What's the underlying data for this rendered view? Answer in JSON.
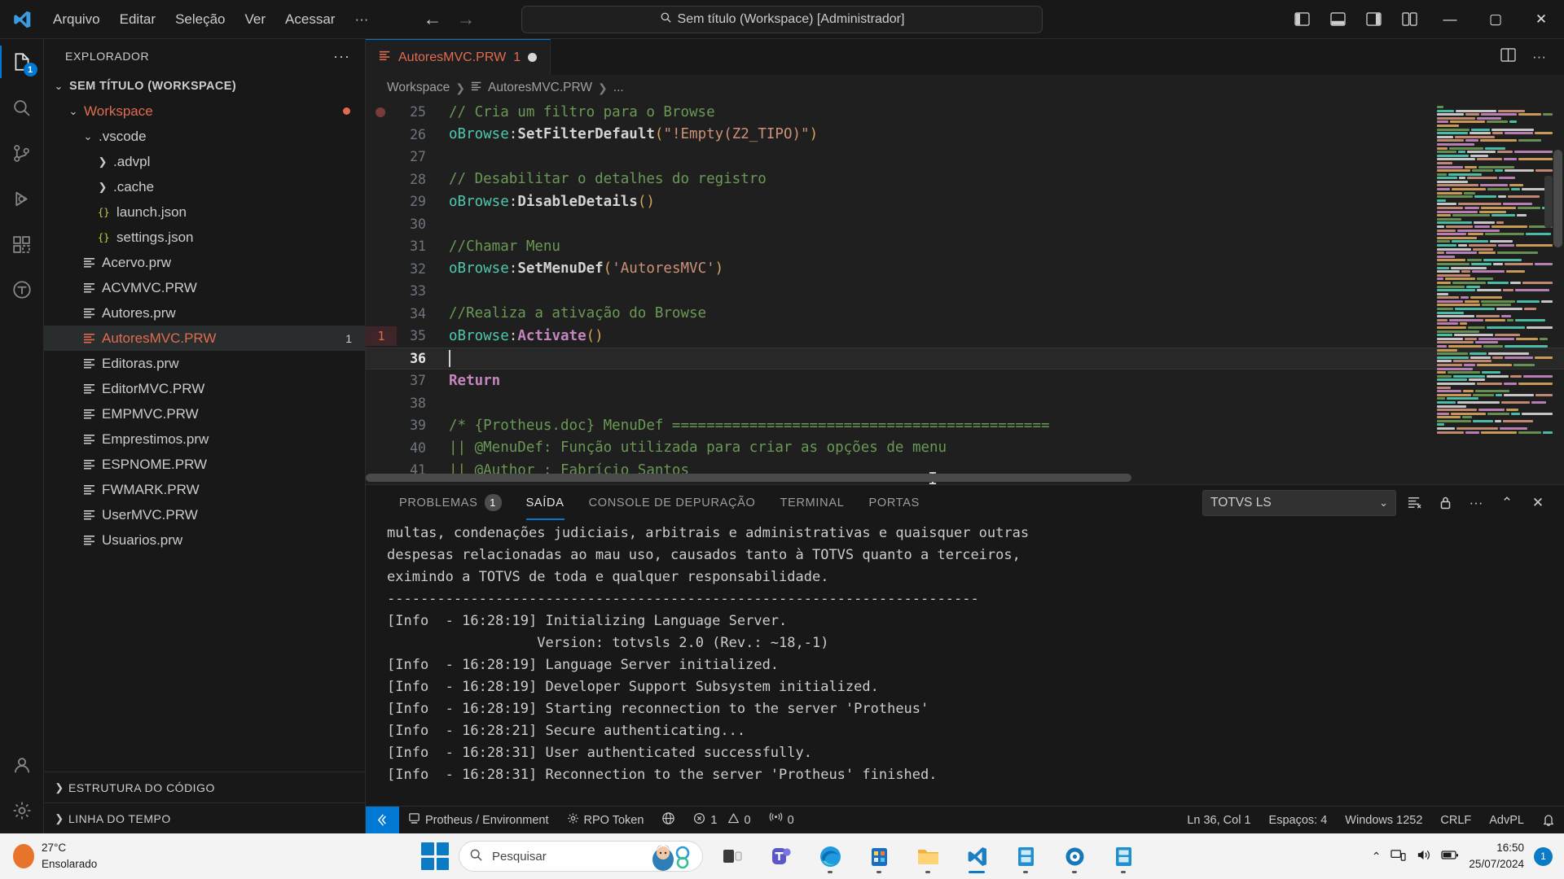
{
  "titlebar": {
    "logo_icon": "vscode-logo-icon",
    "menu": [
      "Arquivo",
      "Editar",
      "Seleção",
      "Ver",
      "Acessar",
      "···"
    ],
    "nav_back_icon": "arrow-left-icon",
    "nav_forward_icon": "arrow-right-icon",
    "command_center": {
      "search_icon": "search-icon",
      "text": "Sem título (Workspace) [Administrador]"
    },
    "layout_icons": [
      "panel-left-icon",
      "panel-bottom-icon",
      "panel-right-icon",
      "editor-layout-icon"
    ],
    "window_controls": {
      "minimize": "—",
      "maximize": "▢",
      "close": "✕"
    }
  },
  "activitybar": {
    "items": [
      {
        "name": "explorer",
        "icon": "files-icon",
        "badge": "1",
        "active": true
      },
      {
        "name": "search",
        "icon": "search-icon",
        "badge": "",
        "active": false
      },
      {
        "name": "source-control",
        "icon": "source-control-icon",
        "badge": "",
        "active": false
      },
      {
        "name": "run-and-debug",
        "icon": "debug-icon",
        "badge": "",
        "active": false
      },
      {
        "name": "extensions",
        "icon": "extensions-icon",
        "badge": "",
        "active": false
      },
      {
        "name": "totvs",
        "icon": "totvs-icon",
        "badge": "",
        "active": false
      }
    ],
    "bottom": [
      {
        "name": "accounts",
        "icon": "account-icon"
      },
      {
        "name": "manage",
        "icon": "gear-icon"
      }
    ]
  },
  "sidebar": {
    "title": "EXPLORADOR",
    "more_icon": "ellipsis-icon",
    "tree": [
      {
        "label": "SEM TÍTULO (WORKSPACE)",
        "indent": 0,
        "twisty": "chevron-down",
        "icon": "",
        "kind": "root"
      },
      {
        "label": "Workspace",
        "indent": 1,
        "twisty": "chevron-down",
        "icon": "",
        "kind": "folder-orange",
        "modified": true
      },
      {
        "label": ".vscode",
        "indent": 2,
        "twisty": "chevron-down",
        "icon": "",
        "kind": "folder"
      },
      {
        "label": ".advpl",
        "indent": 3,
        "twisty": "chevron-right",
        "icon": "",
        "kind": "folder"
      },
      {
        "label": ".cache",
        "indent": 3,
        "twisty": "chevron-right",
        "icon": "",
        "kind": "folder"
      },
      {
        "label": "launch.json",
        "indent": 3,
        "twisty": "",
        "icon": "json-icon",
        "kind": "file"
      },
      {
        "label": "settings.json",
        "indent": 3,
        "twisty": "",
        "icon": "json-icon",
        "kind": "file"
      },
      {
        "label": "Acervo.prw",
        "indent": 2,
        "twisty": "",
        "icon": "advpl-icon",
        "kind": "file"
      },
      {
        "label": "ACVMVC.PRW",
        "indent": 2,
        "twisty": "",
        "icon": "advpl-icon",
        "kind": "file"
      },
      {
        "label": "Autores.prw",
        "indent": 2,
        "twisty": "",
        "icon": "advpl-icon",
        "kind": "file"
      },
      {
        "label": "AutoresMVC.PRW",
        "indent": 2,
        "twisty": "",
        "icon": "advpl-icon",
        "kind": "file",
        "selected": true,
        "error": true,
        "badge": "1"
      },
      {
        "label": "Editoras.prw",
        "indent": 2,
        "twisty": "",
        "icon": "advpl-icon",
        "kind": "file"
      },
      {
        "label": "EditorMVC.PRW",
        "indent": 2,
        "twisty": "",
        "icon": "advpl-icon",
        "kind": "file"
      },
      {
        "label": "EMPMVC.PRW",
        "indent": 2,
        "twisty": "",
        "icon": "advpl-icon",
        "kind": "file"
      },
      {
        "label": "Emprestimos.prw",
        "indent": 2,
        "twisty": "",
        "icon": "advpl-icon",
        "kind": "file"
      },
      {
        "label": "ESPNOME.PRW",
        "indent": 2,
        "twisty": "",
        "icon": "advpl-icon",
        "kind": "file"
      },
      {
        "label": "FWMARK.PRW",
        "indent": 2,
        "twisty": "",
        "icon": "advpl-icon",
        "kind": "file"
      },
      {
        "label": "UserMVC.PRW",
        "indent": 2,
        "twisty": "",
        "icon": "advpl-icon",
        "kind": "file"
      },
      {
        "label": "Usuarios.prw",
        "indent": 2,
        "twisty": "",
        "icon": "advpl-icon",
        "kind": "file"
      }
    ],
    "sections": [
      {
        "label": "ESTRUTURA DO CÓDIGO",
        "twisty": "chevron-right"
      },
      {
        "label": "LINHA DO TEMPO",
        "twisty": "chevron-right"
      }
    ]
  },
  "editor": {
    "tab": {
      "icon": "advpl-icon",
      "label": "AutoresMVC.PRW",
      "problem_count": "1",
      "modified_icon": "modified-dot-icon"
    },
    "tab_actions": [
      "split-editor-icon",
      "more-actions-icon"
    ],
    "breadcrumb": [
      "Workspace",
      "AutoresMVC.PRW",
      "..."
    ],
    "breadcrumb_file_icon": "advpl-icon",
    "lines": [
      {
        "n": "25",
        "tokens": [
          {
            "t": "// Cria um filtro para o Browse",
            "c": "t-com"
          }
        ]
      },
      {
        "n": "26",
        "tokens": [
          {
            "t": "oBrowse",
            "c": "t-var"
          },
          {
            "t": ":",
            "c": "t-punc"
          },
          {
            "t": "SetFilterDefault",
            "c": "t-m"
          },
          {
            "t": "(",
            "c": "t-par"
          },
          {
            "t": "\"!Empty(Z2_TIPO)\"",
            "c": "t-str"
          },
          {
            "t": ")",
            "c": "t-par"
          }
        ]
      },
      {
        "n": "27",
        "tokens": []
      },
      {
        "n": "28",
        "tokens": [
          {
            "t": "// Desabilitar o detalhes do registro",
            "c": "t-com"
          }
        ]
      },
      {
        "n": "29",
        "tokens": [
          {
            "t": "oBrowse",
            "c": "t-var"
          },
          {
            "t": ":",
            "c": "t-punc"
          },
          {
            "t": "DisableDetails",
            "c": "t-m"
          },
          {
            "t": "()",
            "c": "t-par"
          }
        ]
      },
      {
        "n": "30",
        "tokens": []
      },
      {
        "n": "31",
        "tokens": [
          {
            "t": "//Chamar Menu",
            "c": "t-com"
          }
        ]
      },
      {
        "n": "32",
        "tokens": [
          {
            "t": "oBrowse",
            "c": "t-var"
          },
          {
            "t": ":",
            "c": "t-punc"
          },
          {
            "t": "SetMenuDef",
            "c": "t-m"
          },
          {
            "t": "(",
            "c": "t-par"
          },
          {
            "t": "'AutoresMVC'",
            "c": "t-str"
          },
          {
            "t": ")",
            "c": "t-par"
          }
        ]
      },
      {
        "n": "33",
        "tokens": []
      },
      {
        "n": "34",
        "tokens": [
          {
            "t": "//Realiza a ativação do Browse",
            "c": "t-com"
          }
        ]
      },
      {
        "n": "35",
        "tokens": [
          {
            "t": "oBrowse",
            "c": "t-var"
          },
          {
            "t": ":",
            "c": "t-punc"
          },
          {
            "t": "Activate",
            "c": "t-kw"
          },
          {
            "t": "()",
            "c": "t-par"
          }
        ],
        "errorbadge": "1"
      },
      {
        "n": "36",
        "tokens": [],
        "current": true,
        "caret": true
      },
      {
        "n": "37",
        "tokens": [
          {
            "t": "Return",
            "c": "t-kw"
          }
        ]
      },
      {
        "n": "38",
        "tokens": []
      },
      {
        "n": "39",
        "tokens": [
          {
            "t": "/* {Protheus.doc} MenuDef ============================================",
            "c": "t-com"
          }
        ]
      },
      {
        "n": "40",
        "tokens": [
          {
            "t": "|| @MenuDef: Função utilizada para criar as opções de menu",
            "c": "t-com"
          }
        ]
      },
      {
        "n": "41",
        "tokens": [
          {
            "t": "|| @Author : Fabrício Santos",
            "c": "t-com"
          }
        ]
      }
    ]
  },
  "panel": {
    "tabs": [
      {
        "label": "PROBLEMAS",
        "count": "1",
        "active": false
      },
      {
        "label": "SAÍDA",
        "count": "",
        "active": true
      },
      {
        "label": "CONSOLE DE DEPURAÇÃO",
        "count": "",
        "active": false
      },
      {
        "label": "TERMINAL",
        "count": "",
        "active": false
      },
      {
        "label": "PORTAS",
        "count": "",
        "active": false
      }
    ],
    "channel_select": {
      "value": "TOTVS LS",
      "chevron_icon": "chevron-down-icon"
    },
    "actions": [
      "clear-output-icon",
      "lock-scroll-icon",
      "more-actions-icon",
      "maximize-panel-icon",
      "close-panel-icon"
    ],
    "output_lines": [
      "multas, condenações judiciais, arbitrais e administrativas e quaisquer outras",
      "despesas relacionadas ao mau uso, causados tanto à TOTVS quanto a terceiros,",
      "eximindo a TOTVS de toda e qualquer responsabilidade.",
      "-----------------------------------------------------------------------",
      "[Info  - 16:28:19] Initializing Language Server.",
      "                  Version: totvsls 2.0 (Rev.: ~18,-1)",
      "[Info  - 16:28:19] Language Server initialized.",
      "[Info  - 16:28:19] Developer Support Subsystem initialized.",
      "[Info  - 16:28:19] Starting reconnection to the server 'Protheus'",
      "[Info  - 16:28:21] Secure authenticating...",
      "[Info  - 16:28:31] User authenticated successfully.",
      "[Info  - 16:28:31] Reconnection to the server 'Protheus' finished."
    ]
  },
  "statusbar": {
    "remote": {
      "icon": "remote-icon",
      "label": ""
    },
    "left": [
      {
        "icon": "server-icon",
        "label": "Protheus / Environment"
      },
      {
        "icon": "gear-icon",
        "label": "RPO Token"
      },
      {
        "icon": "globe-icon",
        "label": ""
      },
      {
        "icon": "error-icon",
        "label": "1"
      },
      {
        "icon": "warning-icon",
        "label": "0"
      },
      {
        "icon": "radio-tower-icon",
        "label": "0"
      }
    ],
    "right": [
      {
        "label": "Ln 36, Col 1"
      },
      {
        "label": "Espaços: 4"
      },
      {
        "label": "Windows 1252"
      },
      {
        "label": "CRLF"
      },
      {
        "label": "AdvPL"
      },
      {
        "icon": "bell-dot-icon",
        "label": ""
      }
    ]
  },
  "taskbar": {
    "weather": {
      "temp": "27°C",
      "condition": "Ensolarado",
      "icon": "sun-icon"
    },
    "start_icon": "windows-start-icon",
    "search": {
      "placeholder": "Pesquisar",
      "icon": "search-icon",
      "copilot_icon": "copilot-avatar-icon"
    },
    "apps": [
      {
        "name": "task-view",
        "icon": "task-view-icon",
        "running": false
      },
      {
        "name": "teams",
        "icon": "teams-icon",
        "running": false
      },
      {
        "name": "edge",
        "icon": "edge-icon",
        "running": true
      },
      {
        "name": "store",
        "icon": "store-icon",
        "running": true
      },
      {
        "name": "file-explorer",
        "icon": "folder-icon",
        "running": true
      },
      {
        "name": "vscode",
        "icon": "vscode-logo-icon",
        "running": true,
        "active": true
      },
      {
        "name": "totvs-app",
        "icon": "totvs-app-icon",
        "running": true
      },
      {
        "name": "smartclient",
        "icon": "smartclient-icon",
        "running": true
      },
      {
        "name": "totvs-app-2",
        "icon": "totvs-app-icon",
        "running": true
      }
    ],
    "tray": {
      "chevron_icon": "chevron-up-icon",
      "network_icon": "network-icon",
      "volume_icon": "volume-icon",
      "battery_icon": "battery-icon"
    },
    "clock": {
      "time": "16:50",
      "date": "25/07/2024"
    },
    "notification_badge": "1"
  }
}
